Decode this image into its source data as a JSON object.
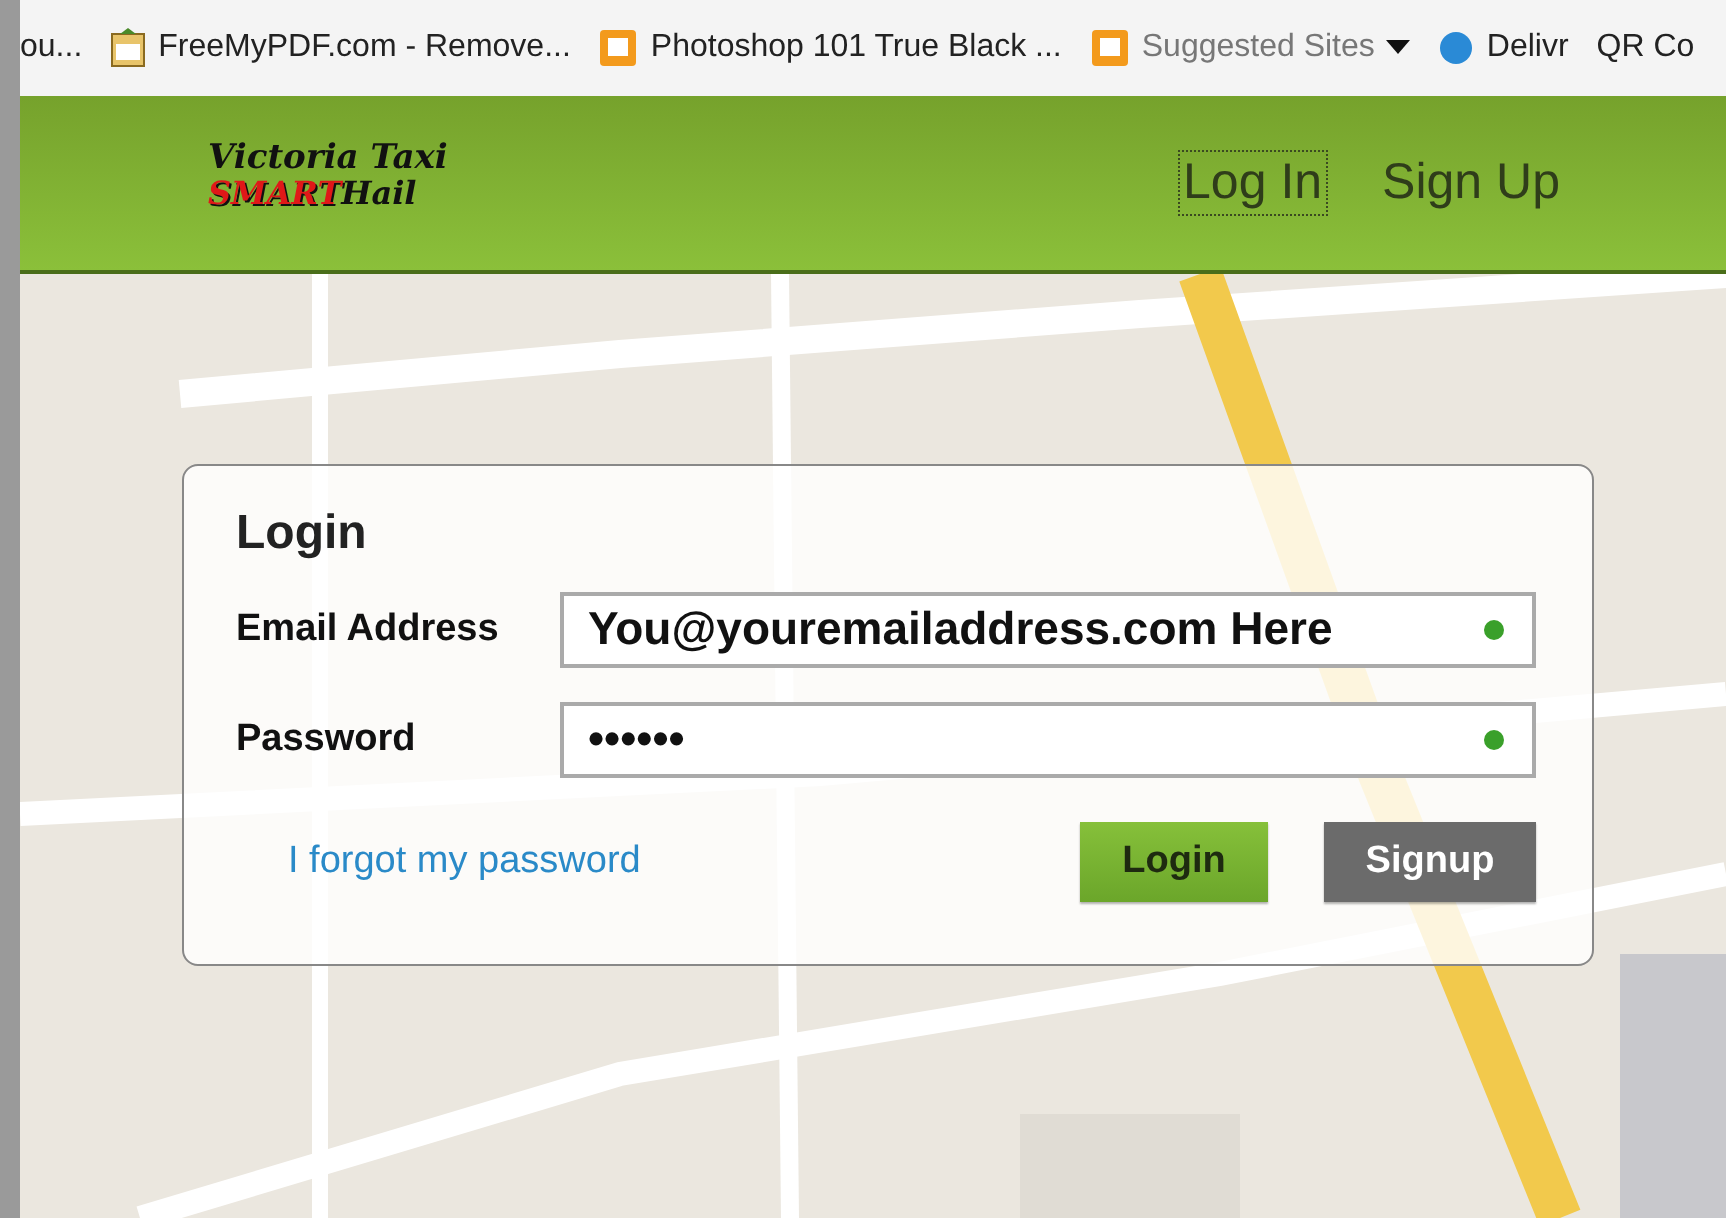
{
  "bookmarks_bar": {
    "items": [
      {
        "label": "ou...",
        "kind": "plain",
        "dropdown": false
      },
      {
        "label": "FreeMyPDF.com - Remove...",
        "kind": "document",
        "dropdown": false
      },
      {
        "label": "Photoshop 101 True Black ...",
        "kind": "square",
        "dropdown": false
      },
      {
        "label": "Suggested Sites",
        "kind": "square",
        "dropdown": true
      },
      {
        "label": "Delivr",
        "kind": "dot",
        "dropdown": false
      },
      {
        "label": "QR Co",
        "kind": "plain",
        "dropdown": false
      }
    ]
  },
  "header": {
    "logo": {
      "line_1": "Victoria Taxi",
      "line_2a": "SMART",
      "line_2b": "Hail"
    },
    "nav": [
      {
        "label": "Log In",
        "selected": true
      },
      {
        "label": "Sign Up",
        "selected": false
      }
    ]
  },
  "login": {
    "title": "Login",
    "fields": [
      {
        "label": "Email Address",
        "value": "You@youremailaddress.com Here",
        "valid": true
      },
      {
        "label": "Password",
        "value": "••••••",
        "valid": true
      }
    ],
    "forgot_link": "I forgot my password",
    "buttons": [
      {
        "label": "Login",
        "kind": "primary"
      },
      {
        "label": "Signup",
        "kind": "secondary"
      }
    ]
  }
}
